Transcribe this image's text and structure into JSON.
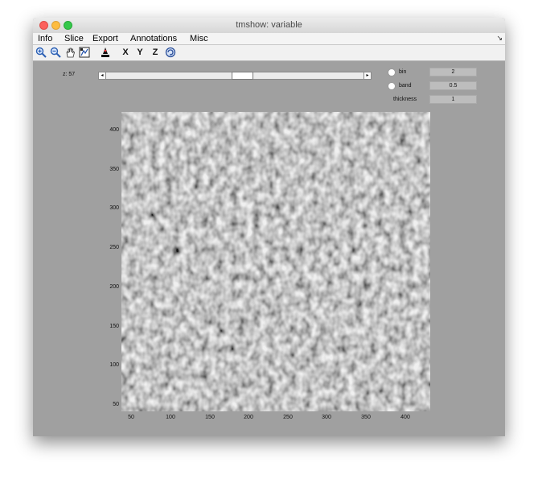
{
  "window": {
    "title": "tmshow: variable"
  },
  "menu": {
    "items": [
      "Info",
      "Slice",
      "Export",
      "Annotations",
      "Misc"
    ],
    "overflow_glyph": "↘"
  },
  "toolbar": {
    "zoom_in_icon": "zoom-in-icon",
    "zoom_out_icon": "zoom-out-icon",
    "pan_icon": "hand-pan-icon",
    "data_cursor_icon": "data-cursor-icon",
    "marker_icon": "marker-icon",
    "x_label": "X",
    "y_label": "Y",
    "z_label": "Z",
    "rotate_icon": "rotate-3d-icon"
  },
  "slice": {
    "z_label": "z:",
    "z_value": "57",
    "arrow_left": "◂",
    "arrow_right": "▸"
  },
  "params": {
    "bin_label": "bin",
    "bin_value": "2",
    "band_label": "band",
    "band_value": "0.5",
    "thickness_label": "thickness",
    "thickness_value": "1"
  },
  "axes": {
    "y_ticks": [
      "400",
      "350",
      "300",
      "250",
      "200",
      "150",
      "100",
      "50"
    ],
    "x_ticks": [
      "50",
      "100",
      "150",
      "200",
      "250",
      "300",
      "350",
      "400"
    ]
  },
  "colors": {
    "window_bg": "#a0a0a0",
    "menubar_bg": "#f4f4f4",
    "toolbar_bg": "#f1f1f1",
    "param_box_bg": "#bdbdbd",
    "image_gray": "#9a9a9a"
  }
}
